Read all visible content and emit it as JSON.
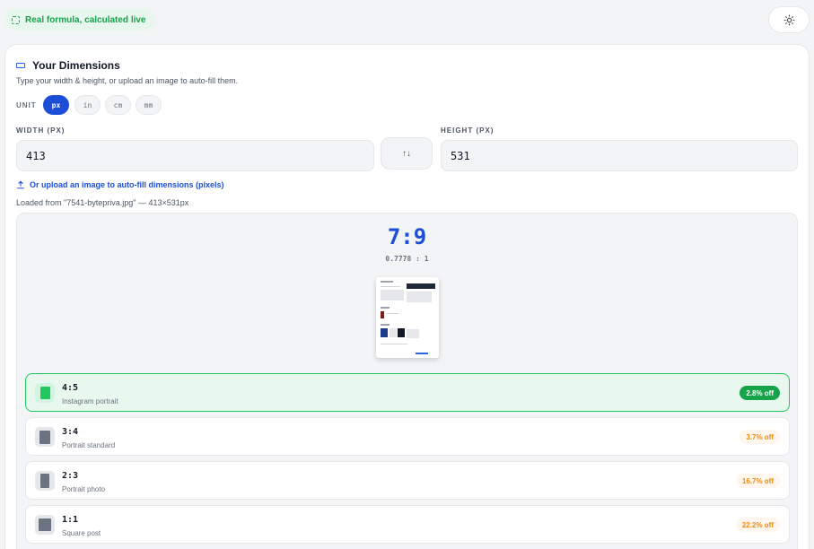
{
  "badge": {
    "label": "Real formula, calculated live"
  },
  "panel": {
    "title": "Your Dimensions",
    "subtitle": "Type your width & height, or upload an image to auto-fill them.",
    "unit_label": "UNIT",
    "units": [
      "px",
      "in",
      "cm",
      "mm"
    ],
    "selected_unit": "px",
    "width_label": "WIDTH (PX)",
    "width_value": "413",
    "height_label": "HEIGHT (PX)",
    "height_value": "531",
    "swap_glyph": "↑↓",
    "upload_link": "Or upload an image to auto-fill dimensions (pixels)",
    "loaded_text": "Loaded from \"7541-bytepriva.jpg\" — 413×531px"
  },
  "result": {
    "ratio": "7:9",
    "decimal": "0.7778 : 1",
    "matches": [
      {
        "ratio": "4:5",
        "desc": "Instagram portrait",
        "off": "2.8% off",
        "best": true
      },
      {
        "ratio": "3:4",
        "desc": "Portrait standard",
        "off": "3.7% off",
        "best": false
      },
      {
        "ratio": "2:3",
        "desc": "Portrait photo",
        "off": "16.7% off",
        "best": false
      },
      {
        "ratio": "1:1",
        "desc": "Square post",
        "off": "22.2% off",
        "best": false
      }
    ]
  },
  "colors": {
    "accent": "#1d4ed8",
    "success": "#16a34a",
    "warning": "#ea8a12"
  },
  "icons": {
    "badge": "dashed-square-icon",
    "theme": "sun-icon",
    "title": "ruler-icon",
    "swap": "swap-arrows-icon",
    "upload": "upload-icon"
  }
}
